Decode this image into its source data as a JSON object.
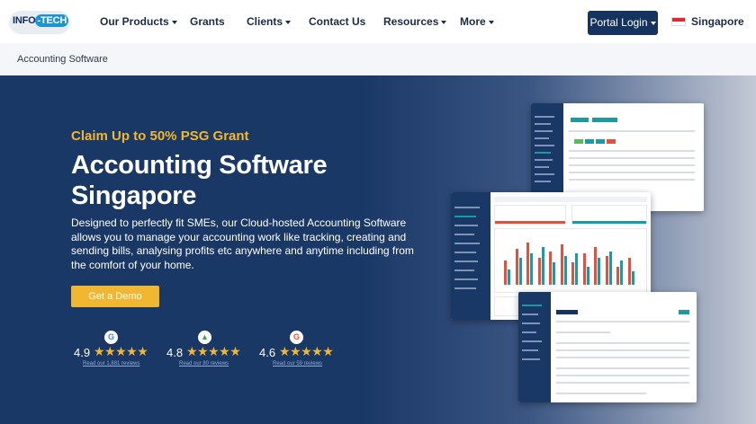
{
  "nav": {
    "logo": {
      "text_a": "INFO",
      "text_b": "TECH",
      "separator": "-"
    },
    "items": [
      {
        "label": "Our Products",
        "has_dropdown": true
      },
      {
        "label": "Grants",
        "has_dropdown": false
      },
      {
        "label": "Clients",
        "has_dropdown": true
      },
      {
        "label": "Contact Us",
        "has_dropdown": false
      },
      {
        "label": "Resources",
        "has_dropdown": true
      },
      {
        "label": "More",
        "has_dropdown": true
      }
    ],
    "portal_login": "Portal Login",
    "country": "Singapore",
    "country_flag_icon": "singapore-flag-icon"
  },
  "breadcrumb": {
    "current": "Accounting Software"
  },
  "hero": {
    "claim": "Claim Up to 50% PSG Grant",
    "title": "Accounting Software Singapore",
    "description": "Designed to perfectly fit SMEs, our Cloud-hosted Accounting Software allows you to manage your accounting work like tracking, creating and sending bills, analysing profits etc anywhere and anytime including from the comfort of your home.",
    "cta": "Get a Demo"
  },
  "ratings": [
    {
      "platform_icon": "google-icon",
      "glyph": "G",
      "color": "#4285f4",
      "score": "4.9",
      "stars": 5,
      "stars_text": "★★★★★",
      "link": "Read our 1,881 reviews"
    },
    {
      "platform_icon": "google-maps-icon",
      "glyph": "▲",
      "color": "#34a853",
      "score": "4.8",
      "stars": 5,
      "stars_text": "★★★★★",
      "link": "Read our 80 reviews"
    },
    {
      "platform_icon": "g2-icon",
      "glyph": "G",
      "color": "#ff492c",
      "score": "4.6",
      "stars": 4.6,
      "stars_text": "★★★★★",
      "link": "Read our 59 reviews"
    }
  ],
  "colors": {
    "navy": "#1a3866",
    "accent_yellow": "#f2b731",
    "teal": "#1a9ba0",
    "chart_red": "#e0523f"
  },
  "screenshot_bars": [
    {
      "a": 0.55,
      "b": 0.35
    },
    {
      "a": 0.8,
      "b": 0.6
    },
    {
      "a": 0.95,
      "b": 0.7
    },
    {
      "a": 0.6,
      "b": 0.85
    },
    {
      "a": 0.75,
      "b": 0.5
    },
    {
      "a": 0.9,
      "b": 0.65
    },
    {
      "a": 0.5,
      "b": 0.7
    },
    {
      "a": 0.7,
      "b": 0.4
    },
    {
      "a": 0.85,
      "b": 0.6
    },
    {
      "a": 0.65,
      "b": 0.75
    },
    {
      "a": 0.4,
      "b": 0.55
    },
    {
      "a": 0.6,
      "b": 0.3
    }
  ]
}
